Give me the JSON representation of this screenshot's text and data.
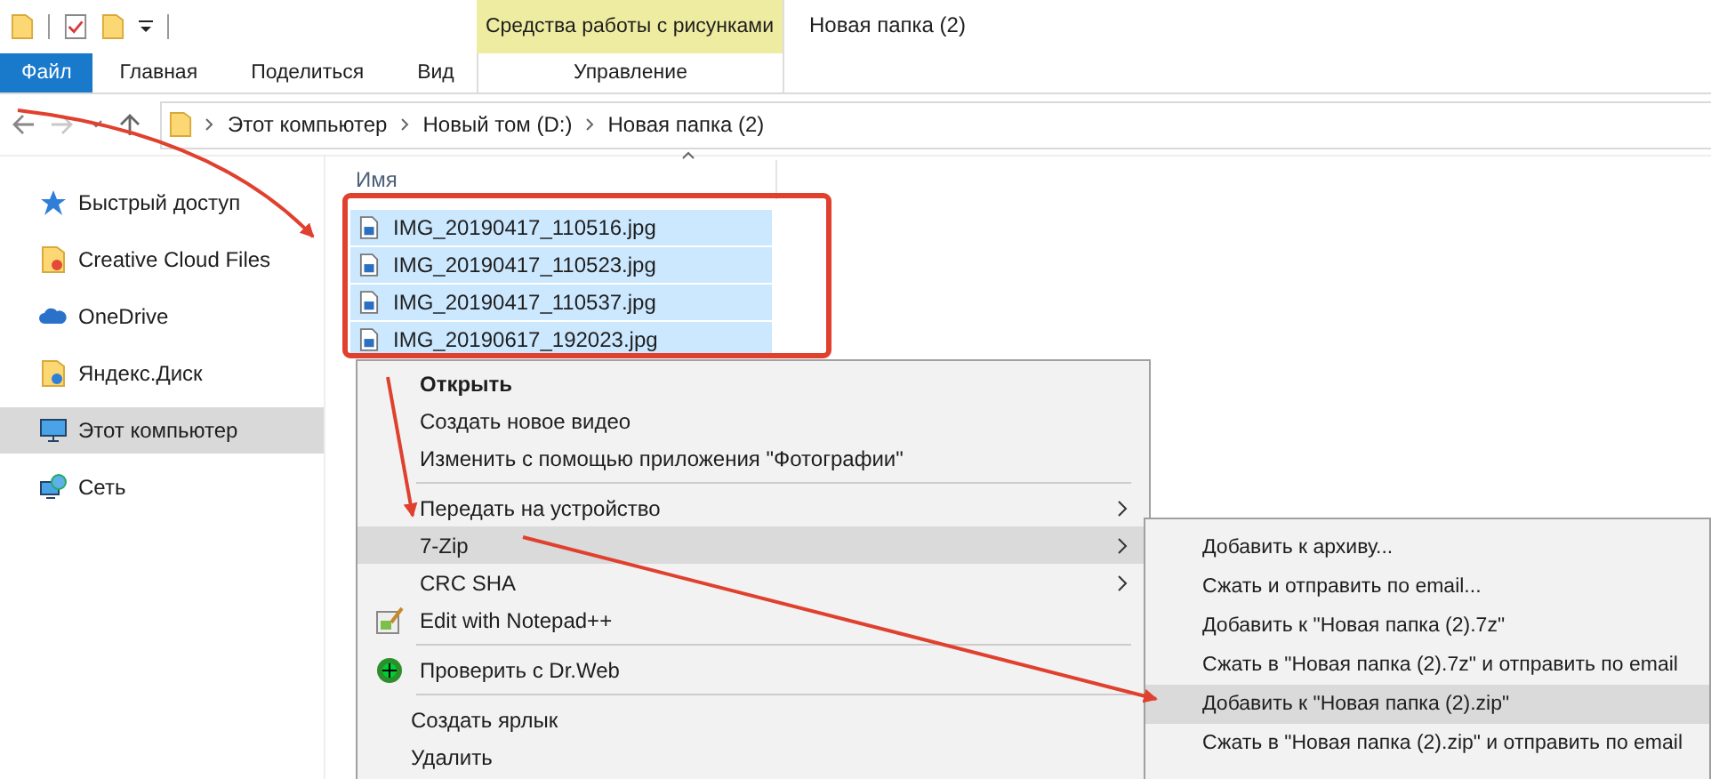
{
  "window": {
    "title": "Новая папка (2)"
  },
  "ribbon": {
    "context_group": "Средства работы с рисунками",
    "tabs": [
      {
        "label": "Файл",
        "kind": "file"
      },
      {
        "label": "Главная",
        "kind": "tab"
      },
      {
        "label": "Поделиться",
        "kind": "tab"
      },
      {
        "label": "Вид",
        "kind": "tab"
      },
      {
        "label": "Управление",
        "kind": "context"
      }
    ]
  },
  "address_bar": {
    "path": [
      "Этот компьютер",
      "Новый том (D:)",
      "Новая папка (2)"
    ]
  },
  "sidebar": {
    "items": [
      {
        "label": "Быстрый доступ",
        "selected": false
      },
      {
        "label": "Creative Cloud Files",
        "selected": false
      },
      {
        "label": "OneDrive",
        "selected": false
      },
      {
        "label": "Яндекс.Диск",
        "selected": false
      },
      {
        "label": "Этот компьютер",
        "selected": true
      },
      {
        "label": "Сеть",
        "selected": false
      }
    ]
  },
  "file_list": {
    "column": "Имя",
    "files": [
      {
        "name": "IMG_20190417_110516.jpg",
        "selected": true
      },
      {
        "name": "IMG_20190417_110523.jpg",
        "selected": true
      },
      {
        "name": "IMG_20190417_110537.jpg",
        "selected": true
      },
      {
        "name": "IMG_20190617_192023.jpg",
        "selected": true
      }
    ]
  },
  "context_menu": {
    "items": [
      {
        "kind": "text",
        "label": "Открыть",
        "bold": true,
        "submenu": false,
        "selected": false
      },
      {
        "kind": "text",
        "label": "Создать новое видео",
        "bold": false,
        "submenu": false,
        "selected": false
      },
      {
        "kind": "text",
        "label": "Изменить с помощью приложения \"Фотографии\"",
        "bold": false,
        "submenu": false,
        "selected": false
      },
      {
        "kind": "separator"
      },
      {
        "kind": "text",
        "label": "Передать на устройство",
        "bold": false,
        "submenu": true,
        "selected": false
      },
      {
        "kind": "text",
        "label": "7-Zip",
        "bold": false,
        "submenu": true,
        "selected": true
      },
      {
        "kind": "text",
        "label": "CRC SHA",
        "bold": false,
        "submenu": true,
        "selected": false
      },
      {
        "kind": "icon_text",
        "label": "Edit with Notepad++",
        "bold": false,
        "submenu": false,
        "selected": false
      },
      {
        "kind": "separator"
      },
      {
        "kind": "icon_text",
        "label": "Проверить с Dr.Web",
        "bold": false,
        "submenu": false,
        "selected": false
      },
      {
        "kind": "separator"
      },
      {
        "kind": "plain",
        "label": "Создать ярлык",
        "bold": false,
        "submenu": false,
        "selected": false
      },
      {
        "kind": "plain",
        "label": "Удалить",
        "bold": false,
        "submenu": false,
        "selected": false
      }
    ]
  },
  "submenu": {
    "items": [
      {
        "label": "Добавить к архиву...",
        "selected": false
      },
      {
        "label": "Сжать и отправить по email...",
        "selected": false
      },
      {
        "label": "Добавить к \"Новая папка (2).7z\"",
        "selected": false
      },
      {
        "label": "Сжать в \"Новая папка (2).7z\" и отправить по email",
        "selected": false
      },
      {
        "label": "Добавить к \"Новая папка (2).zip\"",
        "selected": true
      },
      {
        "label": "Сжать в \"Новая папка (2).zip\" и отправить по email",
        "selected": false
      }
    ]
  }
}
